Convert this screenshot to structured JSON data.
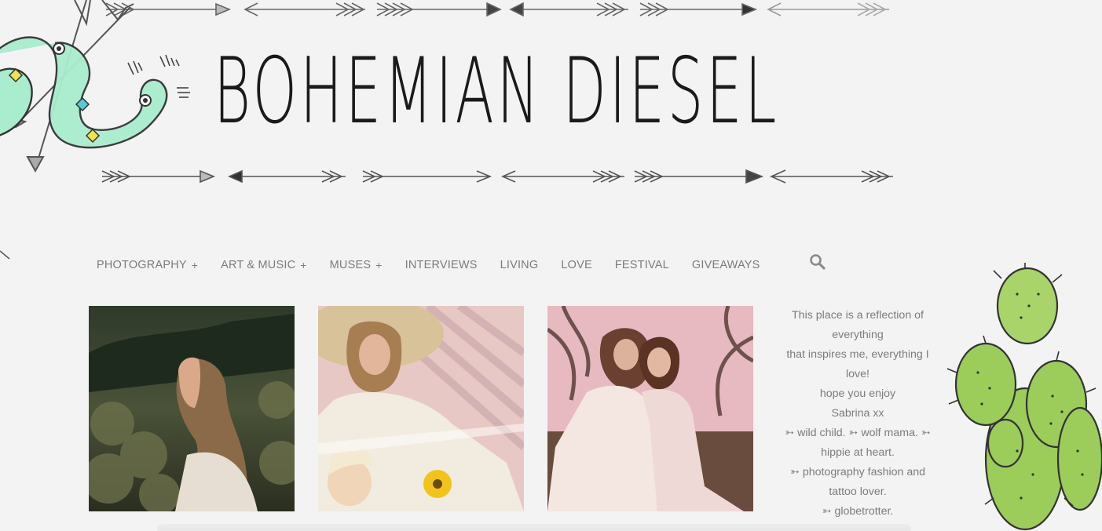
{
  "site": {
    "title": "BOHEMIAN DIESEL"
  },
  "nav": {
    "items": [
      {
        "label": "PHOTOGRAPHY",
        "has_submenu": true
      },
      {
        "label": "ART & MUSIC",
        "has_submenu": true
      },
      {
        "label": "MUSES",
        "has_submenu": true
      },
      {
        "label": "INTERVIEWS",
        "has_submenu": false
      },
      {
        "label": "LIVING",
        "has_submenu": false
      },
      {
        "label": "LOVE",
        "has_submenu": false
      },
      {
        "label": "FESTIVAL",
        "has_submenu": false
      },
      {
        "label": "GIVEAWAYS",
        "has_submenu": false
      }
    ],
    "submenu_marker": "+",
    "search_icon": "search-icon"
  },
  "posts": [
    {
      "subject": "woman with eyes closed in field"
    },
    {
      "subject": "woman in hat with child in hammock"
    },
    {
      "subject": "two women sitting on tree"
    }
  ],
  "about": {
    "lines": [
      "This place is a reflection of",
      "everything",
      "that inspires me, everything I",
      "love!",
      "hope you enjoy",
      "Sabrina xx",
      "➳ wild child. ➳ wolf mama. ➳",
      "hippie at heart.",
      "➳ photography fashion and",
      "tattoo lover.",
      "➳ globetrotter."
    ]
  },
  "colors": {
    "background": "#f3f3f3",
    "nav_text": "#7b7b7b",
    "title_ink": "#1a1a1a",
    "snake": "#9ee6c4",
    "cactus": "#9ccc5a"
  }
}
